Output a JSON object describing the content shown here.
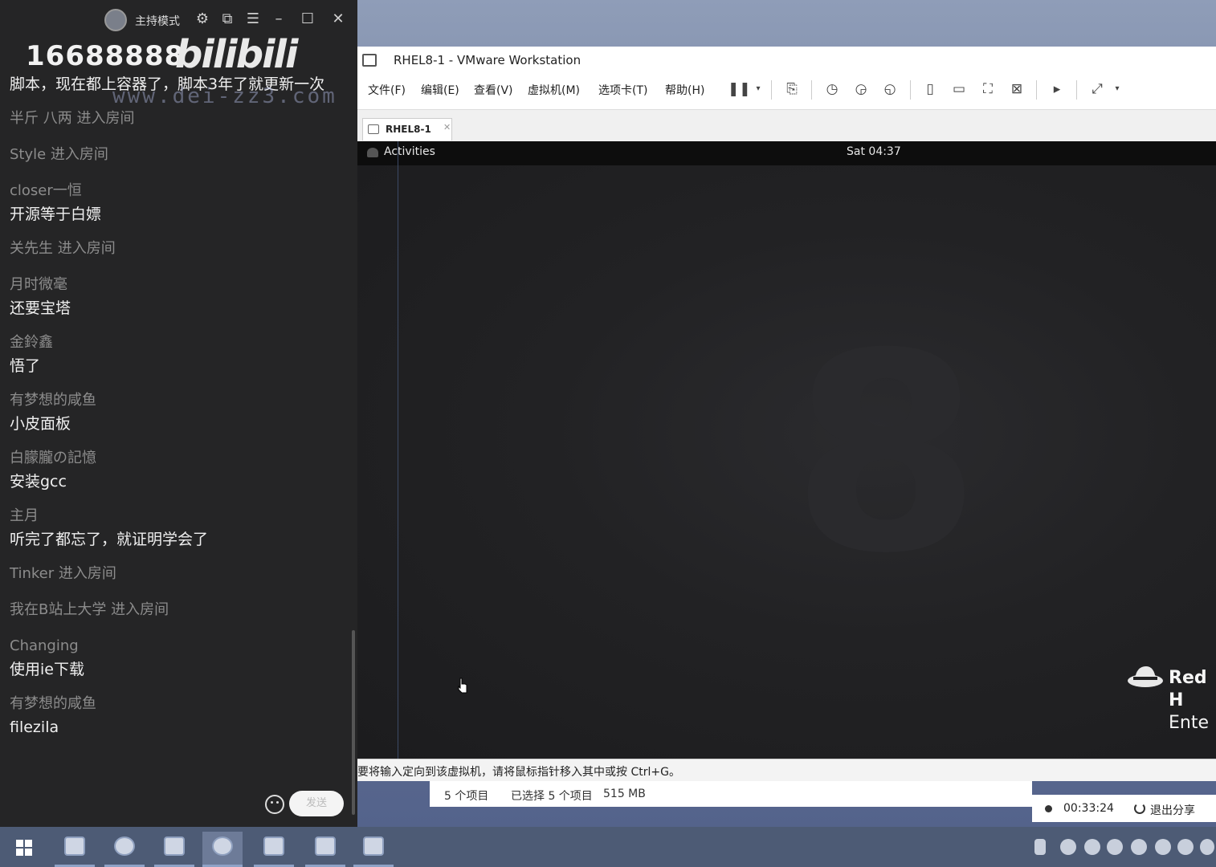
{
  "chat": {
    "host_mode_label": "主持模式",
    "room_number": "16688888",
    "logo_text": "bilibili",
    "watermark": "www.dei-zz3.com",
    "send_label": "发送",
    "messages": [
      {
        "kind": "text",
        "text": "脚本，现在都上容器了，脚本3年了就更新一次"
      },
      {
        "kind": "enter",
        "text": "半斤 八两 进入房间"
      },
      {
        "kind": "enter",
        "text": "Style 进入房间"
      },
      {
        "kind": "msg",
        "user": "closer一恒",
        "text": "开源等于白嫖"
      },
      {
        "kind": "enter",
        "text": "关先生 进入房间"
      },
      {
        "kind": "msg",
        "user": "月时微毫",
        "text": "还要宝塔"
      },
      {
        "kind": "msg",
        "user": "金鈴鑫",
        "text": "悟了"
      },
      {
        "kind": "msg",
        "user": "有梦想的咸鱼",
        "text": "小皮面板"
      },
      {
        "kind": "msg",
        "user": "白朦朧の記憶",
        "text": "安装gcc"
      },
      {
        "kind": "msg",
        "user": "主月",
        "text": "听完了都忘了，就证明学会了"
      },
      {
        "kind": "enter",
        "text": "Tinker 进入房间"
      },
      {
        "kind": "enter",
        "text": "我在B站上大学 进入房间"
      },
      {
        "kind": "msg",
        "user": "Changing",
        "text": "使用ie下载"
      },
      {
        "kind": "msg",
        "user": "有梦想的咸鱼",
        "text": "filezila"
      }
    ]
  },
  "vmware": {
    "title": "RHEL8-1 - VMware Workstation",
    "menus": [
      "文件(F)",
      "编辑(E)",
      "查看(V)",
      "虚拟机(M)",
      "选项卡(T)",
      "帮助(H)"
    ],
    "tab_label": "RHEL8-1",
    "status_hint": "要将输入定向到该虚拟机，请将鼠标指针移入其中或按 Ctrl+G。"
  },
  "guest": {
    "activities": "Activities",
    "clock": "Sat 04:37",
    "wallpaper_digit": "8",
    "brand_line1": "Red H",
    "brand_line2": "Ente"
  },
  "explorer_status": {
    "items_count": "5 个项目",
    "selected": "已选择 5 个项目",
    "size": "515 MB"
  },
  "share": {
    "timer": "00:33:24",
    "stop_label": "退出分享"
  }
}
